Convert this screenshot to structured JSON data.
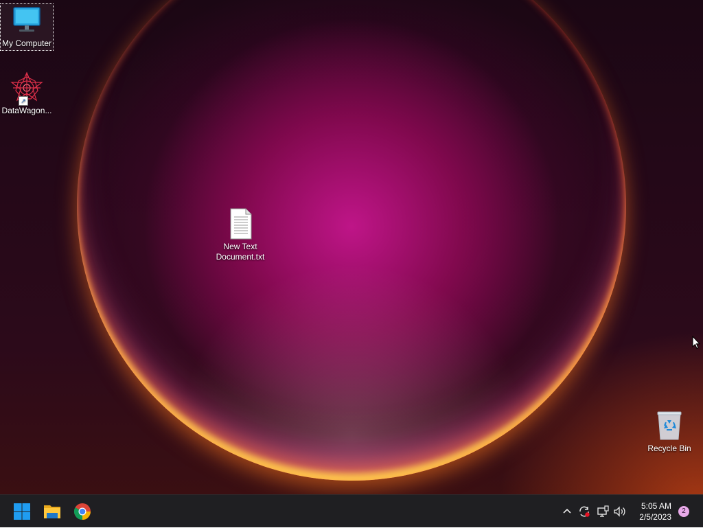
{
  "desktop": {
    "icons": [
      {
        "label": "My Computer",
        "icon": "monitor-icon"
      },
      {
        "label": "DataWagon...",
        "icon": "datawagon-app-icon"
      },
      {
        "label": "New Text Document.txt",
        "icon": "text-document-icon"
      },
      {
        "label": "Recycle Bin",
        "icon": "recycle-bin-icon"
      }
    ]
  },
  "taskbar": {
    "pinned": [
      {
        "name": "Start",
        "icon": "windows-start-icon"
      },
      {
        "name": "File Explorer",
        "icon": "folder-icon"
      },
      {
        "name": "Google Chrome",
        "icon": "chrome-icon"
      }
    ],
    "tray": {
      "icons": [
        "chevron-up-icon",
        "sync-alert-icon",
        "network-icon",
        "volume-icon"
      ],
      "time": "5:05 AM",
      "date": "2/5/2023",
      "notification_count": "2"
    }
  },
  "colors": {
    "taskbar_bg": "#1f1f22",
    "accent_start": "#0b7ce0",
    "badge": "#e8a9e8"
  }
}
